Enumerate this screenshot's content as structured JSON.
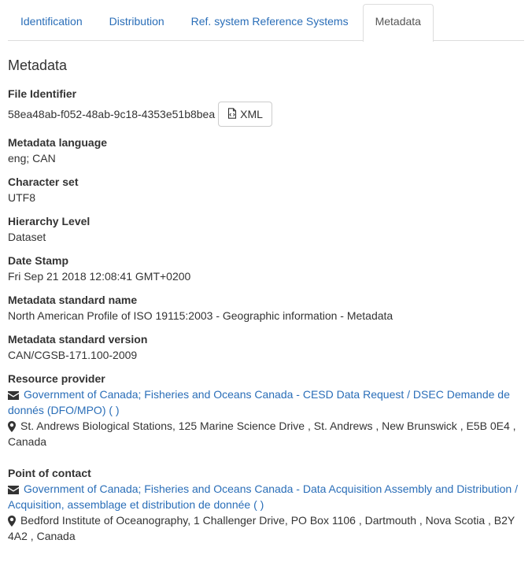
{
  "tabs": [
    {
      "label": "Identification"
    },
    {
      "label": "Distribution"
    },
    {
      "label": "Ref. system Reference Systems"
    },
    {
      "label": "Metadata"
    }
  ],
  "section_title": "Metadata",
  "file_identifier": {
    "label": "File Identifier",
    "value": "58ea48ab-f052-48ab-9c18-4353e51b8bea",
    "xml_button": "XML"
  },
  "fields": [
    {
      "label": "Metadata language",
      "value": "eng; CAN"
    },
    {
      "label": "Character set",
      "value": "UTF8"
    },
    {
      "label": "Hierarchy Level",
      "value": "Dataset"
    },
    {
      "label": "Date Stamp",
      "value": "Fri Sep 21 2018 12:08:41 GMT+0200"
    },
    {
      "label": "Metadata standard name",
      "value": "North American Profile of ISO 19115:2003 - Geographic information - Metadata"
    },
    {
      "label": "Metadata standard version",
      "value": "CAN/CGSB-171.100-2009"
    }
  ],
  "resource_provider": {
    "label": "Resource provider",
    "org": "Government of Canada; Fisheries and Oceans Canada - CESD Data Request / DSEC Demande de donnés (DFO/MPO) ( )",
    "address": "St. Andrews Biological Stations, 125 Marine Science Drive , St. Andrews , New Brunswick , E5B 0E4 , Canada"
  },
  "point_of_contact": {
    "label": "Point of contact",
    "org": "Government of Canada; Fisheries and Oceans Canada - Data Acquisition Assembly and Distribution / Acquisition, assemblage et distribution de donnée ( )",
    "address": "Bedford Institute of Oceanography, 1 Challenger Drive, PO Box 1106 , Dartmouth , Nova Scotia , B2Y 4A2 , Canada"
  }
}
